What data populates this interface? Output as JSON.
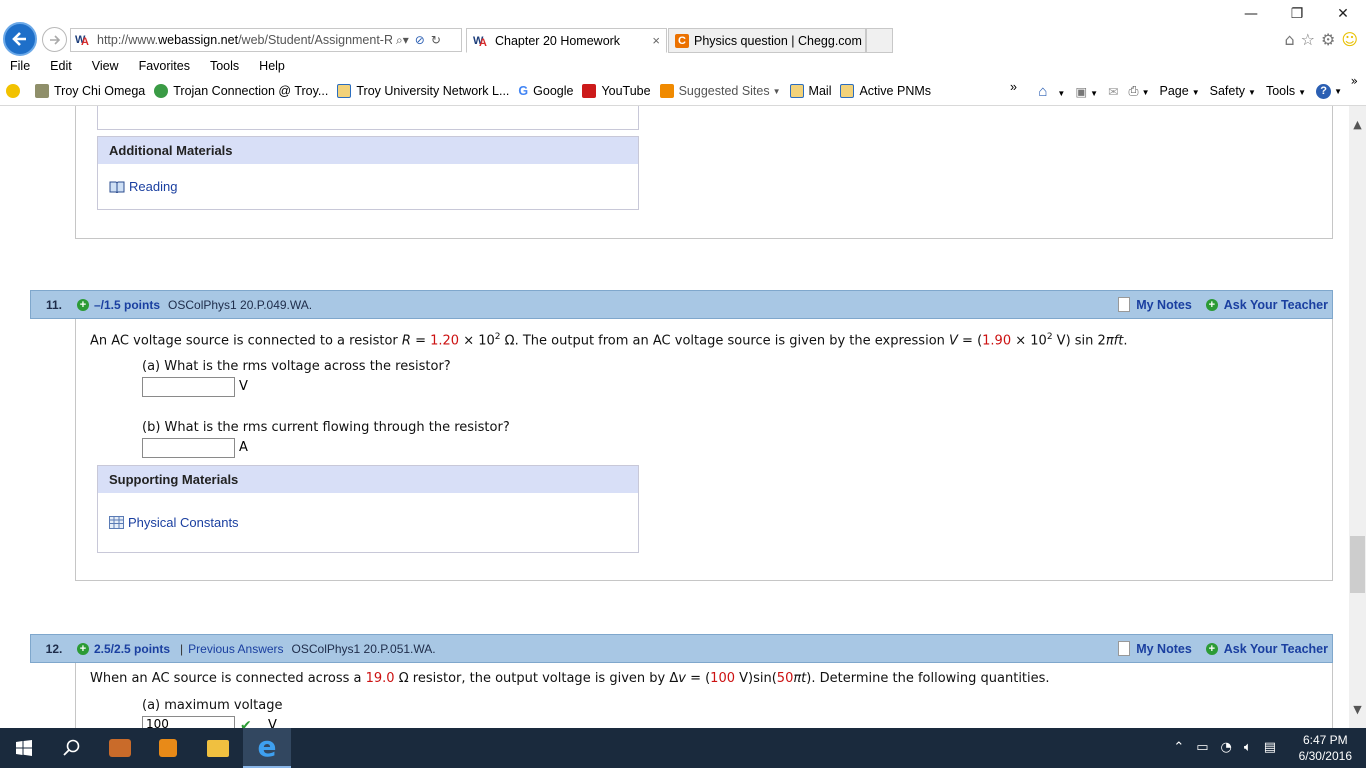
{
  "browser": {
    "address_url_prefix": "http://www.",
    "address_url_domain": "webassign.net",
    "address_url_suffix": "/web/Student/Assignment-R",
    "logo_text": "W",
    "logo_accent": "A",
    "tabs": [
      {
        "label": "Chapter 20 Homework",
        "close": "×"
      },
      {
        "label": "Physics question | Chegg.com"
      }
    ],
    "window_controls": {
      "minimize": "—",
      "restore": "❐",
      "close": "✕"
    },
    "menu": [
      "File",
      "Edit",
      "View",
      "Favorites",
      "Tools",
      "Help"
    ],
    "favorites": [
      "Troy Chi Omega",
      "Trojan Connection @ Troy...",
      "Troy University Network L...",
      "Google",
      "YouTube",
      "Suggested Sites",
      "Mail",
      "Active PNMs"
    ],
    "favorites_more": "»",
    "commands": [
      "Page",
      "Safety",
      "Tools"
    ],
    "command_more": "»"
  },
  "additional_materials": {
    "heading": "Additional Materials",
    "link": "Reading"
  },
  "question_11": {
    "number": "11.",
    "points": "–/1.5 points",
    "code": "OSColPhys1 20.P.049.WA.",
    "my_notes": "My Notes",
    "ask_teacher": "Ask Your Teacher",
    "text_1": "An AC voltage source is connected to a resistor ",
    "var_R": "R",
    "eq_1": " = ",
    "R_value": "1.20",
    "times_1": " × 10",
    "exp_1": "2",
    "text_2": " Ω. The output from an AC voltage source is given by the expression ",
    "var_V": "V",
    "eq_2": " = (",
    "V_value": "1.90",
    "times_2": " × 10",
    "exp_2": "2",
    "text_3": " V) sin 2",
    "pi_ft": "πft",
    "text_4": ".",
    "part_a": "(a) What is the rms voltage across the resistor?",
    "unit_a": "V",
    "part_b": "(b) What is the rms current flowing through the resistor?",
    "unit_b": "A",
    "supporting_heading": "Supporting Materials",
    "supporting_link": "Physical Constants"
  },
  "question_12": {
    "number": "12.",
    "points": "2.5/2.5 points",
    "separator": "|",
    "previous_answers": "Previous Answers",
    "code": "OSColPhys1 20.P.051.WA.",
    "my_notes": "My Notes",
    "ask_teacher": "Ask Your Teacher",
    "text_1": "When an AC source is connected across a ",
    "R_value": "19.0",
    "text_2": " Ω resistor, the output voltage is given by Δ",
    "var_v": "v",
    "text_3": " = (",
    "amp_value": "100",
    "text_4": " V)sin(",
    "freq_value": "50",
    "pi_t": "πt",
    "text_5": "). Determine the following quantities.",
    "part_a": "(a) maximum voltage",
    "answer_a": "100",
    "unit_a": "V",
    "check": "✔"
  },
  "taskbar": {
    "time": "6:47 PM",
    "date": "6/30/2016"
  },
  "colors": {
    "accent_link": "#1a3fa0",
    "question_header": "#a8c7e4",
    "materials_header": "#d8dff7",
    "value_red": "#cc1111",
    "correct_green": "#2c9b35"
  },
  "icons": [
    "back-arrow-icon",
    "forward-arrow-icon",
    "search-icon",
    "stop-icon",
    "refresh-icon",
    "home-icon",
    "star-icon",
    "gear-icon",
    "smiley-icon",
    "book-icon",
    "table-icon",
    "plus-icon",
    "notes-icon",
    "windows-icon",
    "cortana-search-icon",
    "edge-icon"
  ]
}
